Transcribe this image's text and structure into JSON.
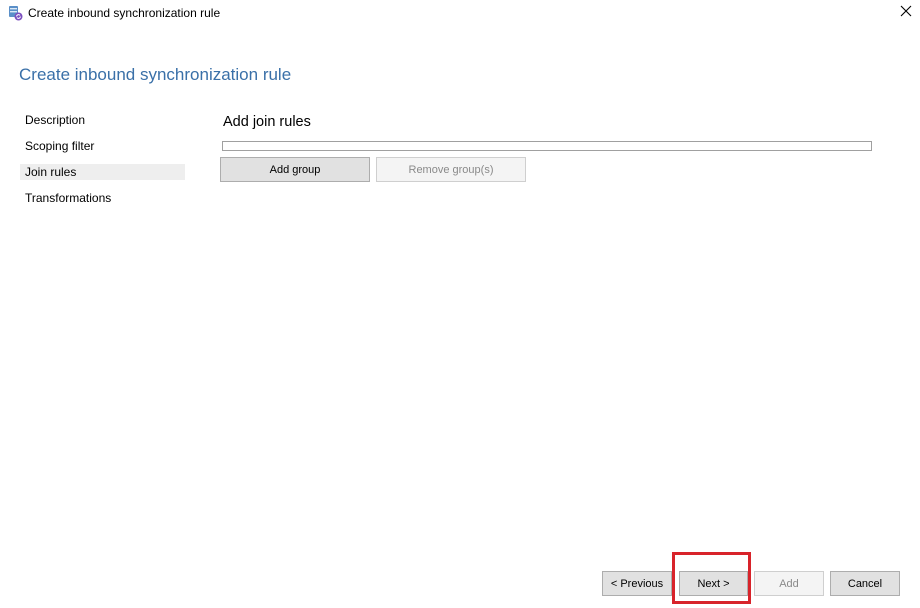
{
  "window": {
    "title": "Create inbound synchronization rule",
    "close_icon": "close-icon",
    "app_icon": "sync-service-icon"
  },
  "page": {
    "title": "Create inbound synchronization rule"
  },
  "nav": {
    "items": [
      {
        "label": "Description",
        "selected": false
      },
      {
        "label": "Scoping filter",
        "selected": false
      },
      {
        "label": "Join rules",
        "selected": true
      },
      {
        "label": "Transformations",
        "selected": false
      }
    ]
  },
  "content": {
    "section_title": "Add join rules",
    "add_group_label": "Add group",
    "remove_group_label": "Remove group(s)"
  },
  "footer": {
    "previous_label": "< Previous",
    "next_label": "Next >",
    "add_label": "Add",
    "cancel_label": "Cancel"
  },
  "colors": {
    "title_accent": "#3a70a8",
    "highlight": "#d8232a",
    "selected_nav_bg": "#eeeeee"
  }
}
